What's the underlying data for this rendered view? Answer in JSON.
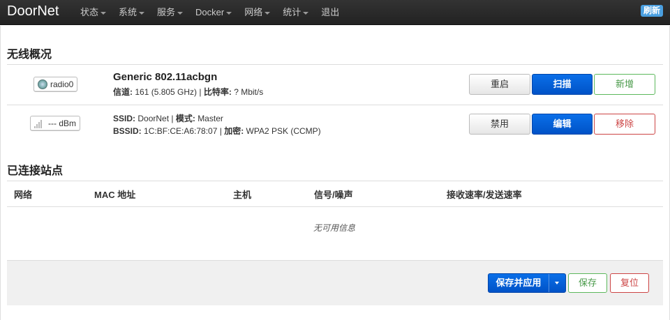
{
  "nav": {
    "brand": "DoorNet",
    "menu": [
      "状态",
      "系统",
      "服务",
      "Docker",
      "网络",
      "统计"
    ],
    "logout": "退出",
    "refresh_badge": "刷新"
  },
  "wireless": {
    "heading": "无线概况",
    "radio": {
      "badge": "radio0",
      "title": "Generic 802.11acbgn",
      "channel_label": "信道:",
      "channel_value": "161 (5.805 GHz)",
      "bitrate_label": "比特率:",
      "bitrate_value": "? Mbit/s",
      "buttons": {
        "restart": "重启",
        "scan": "扫描",
        "add": "新增"
      }
    },
    "network": {
      "badge": "--- dBm",
      "ssid_label": "SSID:",
      "ssid_value": "DoorNet",
      "mode_label": "模式:",
      "mode_value": "Master",
      "bssid_label": "BSSID:",
      "bssid_value": "1C:BF:CE:A6:78:07",
      "encryption_label": "加密:",
      "encryption_value": "WPA2 PSK (CCMP)",
      "buttons": {
        "disable": "禁用",
        "edit": "编辑",
        "remove": "移除"
      }
    }
  },
  "stations": {
    "heading": "已连接站点",
    "columns": [
      "网络",
      "MAC 地址",
      "主机",
      "信号/噪声",
      "接收速率/发送速率"
    ],
    "empty": "无可用信息"
  },
  "actions": {
    "save_apply": "保存并应用",
    "save": "保存",
    "reset": "复位"
  }
}
